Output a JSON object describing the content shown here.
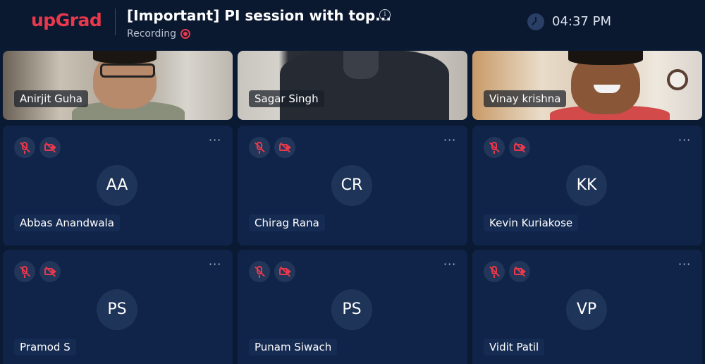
{
  "header": {
    "logo": "upGrad",
    "title": "[Important] PI session with top...",
    "recording_label": "Recording",
    "time": "04:37 PM"
  },
  "video_tiles": [
    {
      "name": "Anirjit Guha"
    },
    {
      "name": "Sagar Singh"
    },
    {
      "name": "Vinay krishna"
    }
  ],
  "participant_tiles": [
    {
      "initials": "AA",
      "name": "Abbas Anandwala",
      "mic": "muted",
      "camera": "off"
    },
    {
      "initials": "CR",
      "name": "Chirag Rana",
      "mic": "muted",
      "camera": "off"
    },
    {
      "initials": "KK",
      "name": "Kevin Kuriakose",
      "mic": "muted",
      "camera": "off"
    },
    {
      "initials": "PS",
      "name": "Pramod S",
      "mic": "muted",
      "camera": "off"
    },
    {
      "initials": "PS",
      "name": "Punam Siwach",
      "mic": "muted",
      "camera": "off"
    },
    {
      "initials": "VP",
      "name": "Vidit Patil",
      "mic": "muted",
      "camera": "off"
    }
  ],
  "more_label": "···",
  "colors": {
    "background": "#0b1a33",
    "tile": "#10244a",
    "accent_red": "#e8384c"
  }
}
